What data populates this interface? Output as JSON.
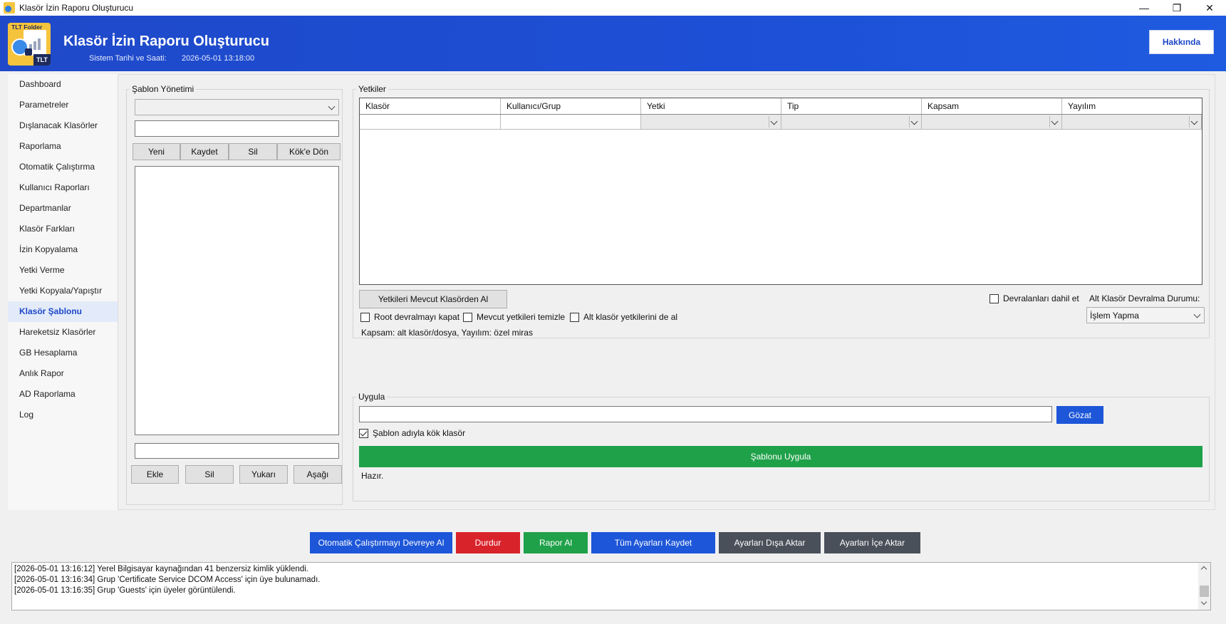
{
  "window": {
    "title": "Klasör İzin Raporu Oluşturucu",
    "minimize": "—",
    "maximize": "❐",
    "close": "✕"
  },
  "header": {
    "logo_top": "TLT Folder",
    "logo_badge": "TLT",
    "title": "Klasör İzin Raporu Oluşturucu",
    "datetime_label": "Sistem Tarihi ve Saati:",
    "datetime_value": "2026-05-01 13:18:00",
    "about_label": "Hakkında"
  },
  "sidebar": {
    "items": [
      {
        "label": "Dashboard"
      },
      {
        "label": "Parametreler"
      },
      {
        "label": "Dışlanacak Klasörler"
      },
      {
        "label": "Raporlama"
      },
      {
        "label": "Otomatik Çalıştırma"
      },
      {
        "label": "Kullanıcı Raporları"
      },
      {
        "label": "Departmanlar"
      },
      {
        "label": "Klasör Farkları"
      },
      {
        "label": "İzin Kopyalama"
      },
      {
        "label": "Yetki Verme"
      },
      {
        "label": "Yetki Kopyala/Yapıştır"
      },
      {
        "label": "Klasör Şablonu",
        "active": true
      },
      {
        "label": "Hareketsiz Klasörler"
      },
      {
        "label": "GB Hesaplama"
      },
      {
        "label": "Anlık Rapor"
      },
      {
        "label": "AD Raporlama"
      },
      {
        "label": "Log"
      }
    ]
  },
  "template_mgmt": {
    "title": "Şablon Yönetimi",
    "new_label": "Yeni",
    "save_label": "Kaydet",
    "delete_label": "Sil",
    "back_label": "Kök'e Dön",
    "add_label": "Ekle",
    "remove_label": "Sil",
    "up_label": "Yukarı",
    "down_label": "Aşağı"
  },
  "permissions": {
    "title": "Yetkiler",
    "columns": [
      "Klasör",
      "Kullanıcı/Grup",
      "Yetki",
      "Tip",
      "Kapsam",
      "Yayılım"
    ],
    "get_from_existing_label": "Yetkileri Mevcut Klasörden Al",
    "include_inherited_label": "Devralanları dahil et",
    "include_inherited_checked": false,
    "subfolder_inherit_label": "Alt Klasör Devralma Durumu:",
    "subfolder_inherit_value": "İşlem Yapma",
    "disable_root_inherit_label": "Root devralmayı kapat",
    "disable_root_inherit_checked": false,
    "clear_existing_label": "Mevcut yetkileri temizle",
    "clear_existing_checked": false,
    "include_subfolder_label": "Alt klasör yetkilerini de al",
    "include_subfolder_checked": false,
    "scope_note": "Kapsam: alt klasör/dosya, Yayılım: özel miras"
  },
  "apply": {
    "title": "Uygula",
    "path_value": "",
    "browse_label": "Gözat",
    "root_with_template_label": "Şablon adıyla kök klasör",
    "root_with_template_checked": true,
    "apply_label": "Şablonu Uygula",
    "status": "Hazır."
  },
  "actions": [
    {
      "label": "Otomatik Çalıştırmayı Devreye Al",
      "color": "#1d56d8"
    },
    {
      "label": "Durdur",
      "color": "#d9232b"
    },
    {
      "label": "Rapor Al",
      "color": "#1fa149"
    },
    {
      "label": "Tüm Ayarları Kaydet",
      "color": "#1d56d8"
    },
    {
      "label": "Ayarları Dışa Aktar",
      "color": "#4a505a"
    },
    {
      "label": "Ayarları İçe Aktar",
      "color": "#4a505a"
    }
  ],
  "log": {
    "lines": [
      "[2026-05-01 13:16:12] Yerel Bilgisayar kaynağından 41 benzersiz kimlik yüklendi.",
      "[2026-05-01 13:16:34] Grup 'Certificate Service DCOM Access' için üye bulunamadı.",
      "[2026-05-01 13:16:35] Grup 'Guests' için üyeler görüntülendi."
    ]
  }
}
